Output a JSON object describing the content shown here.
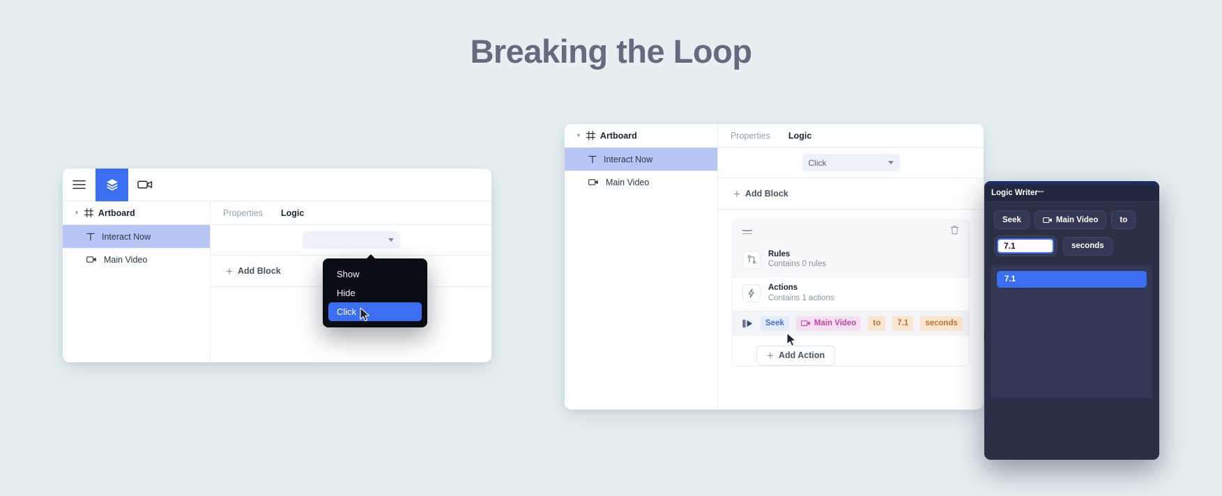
{
  "page": {
    "title": "Breaking the Loop",
    "background_color": "#e6f0f2",
    "title_color": "#636b7e",
    "accent_blue": "#3b6ef0"
  },
  "panel_left": {
    "toolbar": {
      "menu_icon": "hamburger-icon",
      "layers_icon": "layers-icon",
      "video_icon": "video-camera-icon"
    },
    "layers": {
      "root_label": "Artboard",
      "root_icon": "artboard-icon",
      "items": [
        {
          "label": "Interact Now",
          "icon": "text-icon",
          "selected": true
        },
        {
          "label": "Main Video",
          "icon": "video-icon",
          "selected": false
        }
      ]
    },
    "tabs": [
      {
        "label": "Properties",
        "active": false
      },
      {
        "label": "Logic",
        "active": true
      }
    ],
    "trigger_select": {
      "value": "",
      "placeholder": ""
    },
    "add_block_label": "Add Block",
    "menu": {
      "items": [
        {
          "label": "Show",
          "highlighted": false
        },
        {
          "label": "Hide",
          "highlighted": false
        },
        {
          "label": "Click",
          "highlighted": true
        }
      ]
    }
  },
  "panel_right": {
    "layers": {
      "root_label": "Artboard",
      "root_icon": "artboard-icon",
      "items": [
        {
          "label": "Interact Now",
          "icon": "text-icon",
          "selected": true
        },
        {
          "label": "Main Video",
          "icon": "video-icon",
          "selected": false
        }
      ]
    },
    "tabs": [
      {
        "label": "Properties",
        "active": false
      },
      {
        "label": "Logic",
        "active": true
      }
    ],
    "trigger_select": {
      "value": "Click"
    },
    "add_block_label": "Add Block",
    "block": {
      "drag_handle_icon": "drag-handle-icon",
      "delete_icon": "trash-icon",
      "rules": {
        "icon": "rules-branch-icon",
        "title": "Rules",
        "subtitle": "Contains 0 rules"
      },
      "actions": {
        "icon": "lightning-icon",
        "title": "Actions",
        "subtitle": "Contains 1 actions"
      },
      "action_row": {
        "icon": "seek-icon",
        "verb": "Seek",
        "target_icon": "video-icon",
        "target": "Main Video",
        "preposition": "to",
        "value": "7.1",
        "unit": "seconds",
        "delete_icon": "trash-icon"
      },
      "add_action_label": "Add Action"
    }
  },
  "logic_writer": {
    "title": "Logic Writer",
    "trademark": "″″",
    "chips": [
      {
        "label": "Seek",
        "icon": null
      },
      {
        "label": "Main Video",
        "icon": "video-icon"
      },
      {
        "label": "to",
        "icon": null
      }
    ],
    "input": {
      "value": "7.1"
    },
    "unit_chip": "seconds",
    "suggestions": [
      {
        "label": "7.1",
        "highlighted": true
      }
    ]
  }
}
